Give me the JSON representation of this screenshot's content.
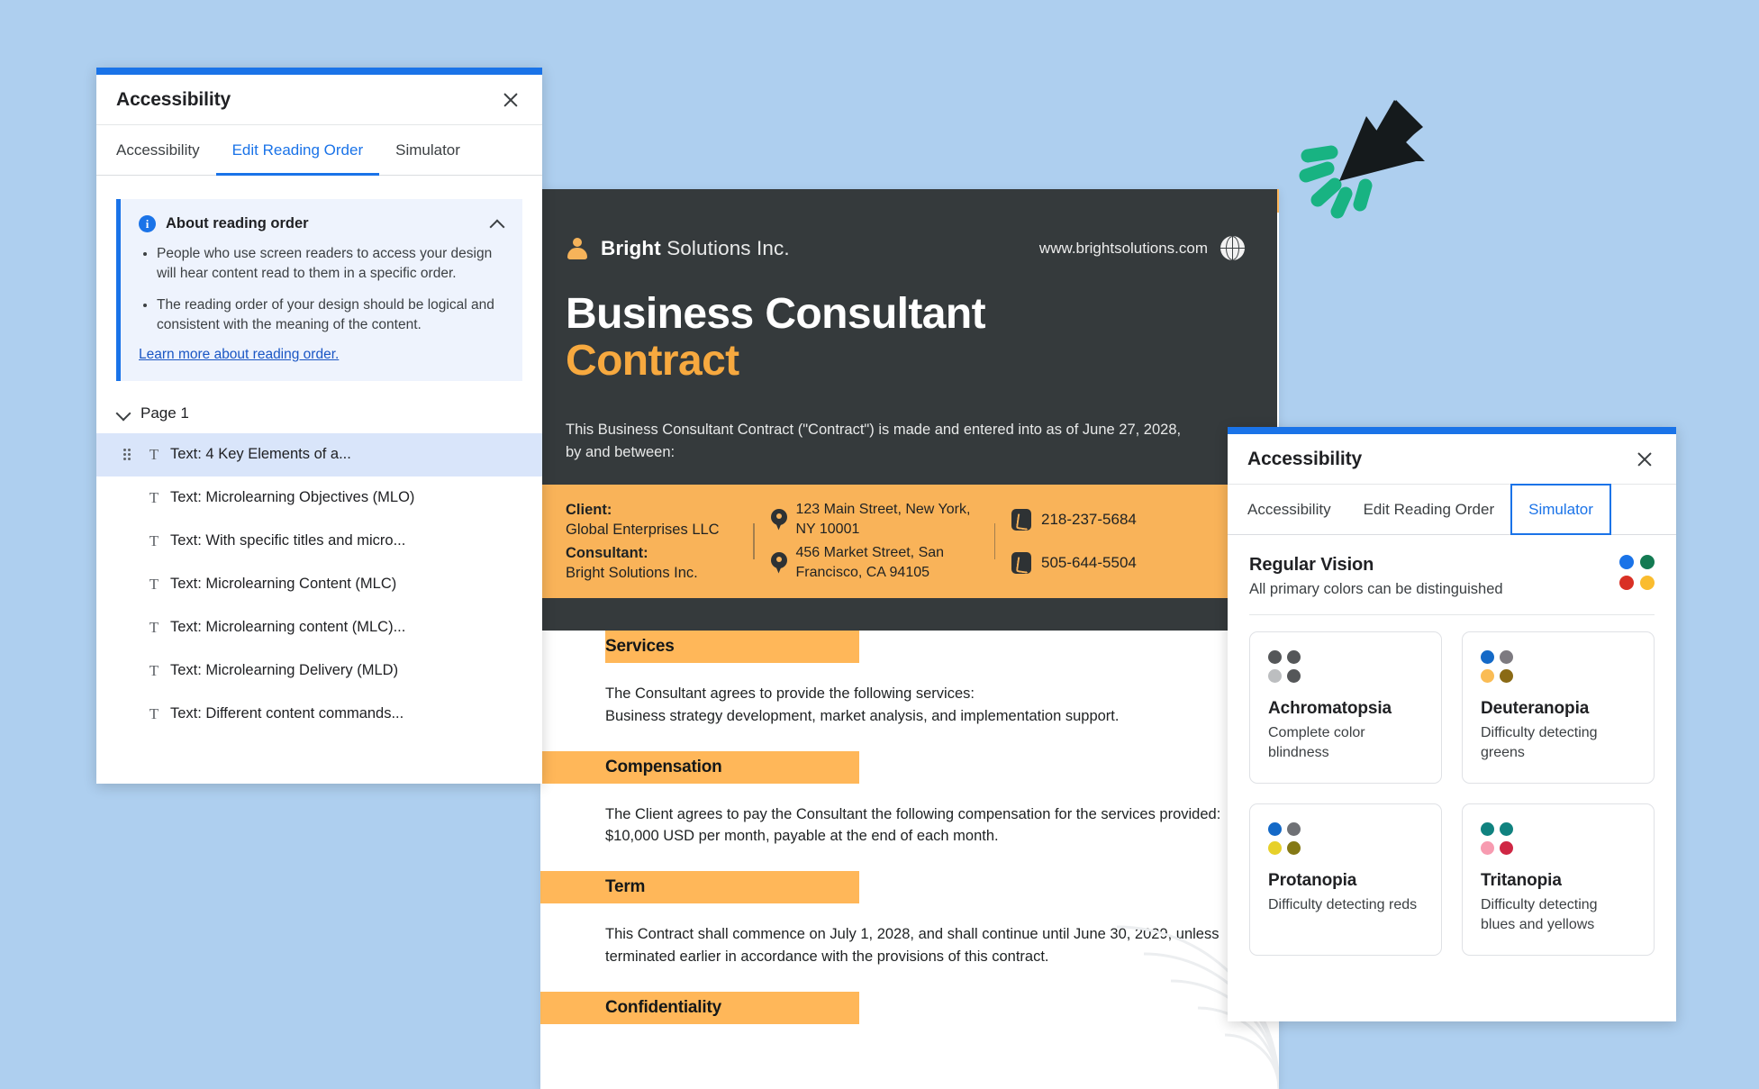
{
  "background_color": "#aecfef",
  "document": {
    "brand": {
      "name_bold": "Bright",
      "name_rest": " Solutions Inc.",
      "logo_icon": "person-avatar-icon"
    },
    "website": "www.brightsolutions.com",
    "globe_icon": "globe-icon",
    "title_line1": "Business Consultant",
    "title_line2": "Contract",
    "intro": "This Business Consultant Contract (\"Contract\") is made and entered into as of June 27, 2028, by and between:",
    "contacts": [
      {
        "label": "Client:",
        "value": "Global Enterprises LLC",
        "address": "123 Main Street, New York, NY 10001",
        "phone": "218-237-5684"
      },
      {
        "label": "Consultant:",
        "value": "Bright Solutions Inc.",
        "address": "456 Market Street, San Francisco, CA 94105",
        "phone": "505-644-5504"
      }
    ],
    "sections": [
      {
        "heading": "Services",
        "body": "The Consultant agrees to provide the following services:\nBusiness strategy development, market analysis, and implementation support."
      },
      {
        "heading": "Compensation",
        "body": "The Client agrees to pay the Consultant the following compensation for the services provided: $10,000 USD per month, payable at the end of each month."
      },
      {
        "heading": "Term",
        "body": "This Contract shall commence on July 1, 2028, and shall continue until June 30, 2029, unless terminated earlier in accordance with the provisions of this contract."
      },
      {
        "heading": "Confidentiality",
        "body": ""
      }
    ],
    "colors": {
      "hero_bg": "#353a3c",
      "accent_orange": "#ffb759",
      "title_orange": "#f7a93f"
    }
  },
  "reading_panel": {
    "title": "Accessibility",
    "close_label": "×",
    "tabs": [
      {
        "label": "Accessibility",
        "state": "inactive"
      },
      {
        "label": "Edit Reading Order",
        "state": "active"
      },
      {
        "label": "Simulator",
        "state": "inactive"
      }
    ],
    "info": {
      "icon": "info-icon",
      "title": "About reading order",
      "collapse_icon": "chevron-up-icon",
      "bullets": [
        "People who use screen readers to access your design will hear content read to them in a specific order.",
        "The reading order of your design should be logical and consistent with the meaning of the content."
      ],
      "link": "Learn more about reading order."
    },
    "page_group": {
      "label": "Page 1",
      "expand_icon": "chevron-down-icon"
    },
    "items": [
      {
        "label": "Text: 4 Key Elements of a...",
        "selected": true
      },
      {
        "label": "Text: Microlearning Objectives (MLO)",
        "selected": false
      },
      {
        "label": "Text: With specific titles and micro...",
        "selected": false
      },
      {
        "label": "Text: Microlearning Content (MLC)",
        "selected": false
      },
      {
        "label": "Text: Microlearning content (MLC)...",
        "selected": false
      },
      {
        "label": "Text: Microlearning Delivery (MLD)",
        "selected": false
      },
      {
        "label": "Text: Different content commands...",
        "selected": false
      }
    ]
  },
  "simulator_panel": {
    "title": "Accessibility",
    "close_label": "×",
    "tabs": [
      {
        "label": "Accessibility",
        "state": "inactive"
      },
      {
        "label": "Edit Reading Order",
        "state": "inactive"
      },
      {
        "label": "Simulator",
        "state": "focused"
      }
    ],
    "current": {
      "name": "Regular Vision",
      "description": "All primary colors can be distinguished",
      "swatches": [
        "#1a73e8",
        "#137a52",
        "#d93025",
        "#fabc2e"
      ]
    },
    "modes": [
      {
        "name": "Achromatopsia",
        "description": "Complete color blindness",
        "swatches": [
          "#555759",
          "#555759",
          "#bcbec0",
          "#555759"
        ]
      },
      {
        "name": "Deuteranopia",
        "description": "Difficulty detecting greens",
        "swatches": [
          "#1469c7",
          "#7d7a80",
          "#fabc55",
          "#8a6a15"
        ]
      },
      {
        "name": "Protanopia",
        "description": "Difficulty detecting reds",
        "swatches": [
          "#1469c7",
          "#6f7175",
          "#e7d02a",
          "#857915"
        ]
      },
      {
        "name": "Tritanopia",
        "description": "Difficulty detecting blues and yellows",
        "swatches": [
          "#10827f",
          "#10827f",
          "#f79bb0",
          "#cf2744"
        ]
      }
    ]
  },
  "cursor": {
    "icon": "click-cursor-icon",
    "burst_color": "#18b382",
    "cursor_color": "#151a1c"
  }
}
